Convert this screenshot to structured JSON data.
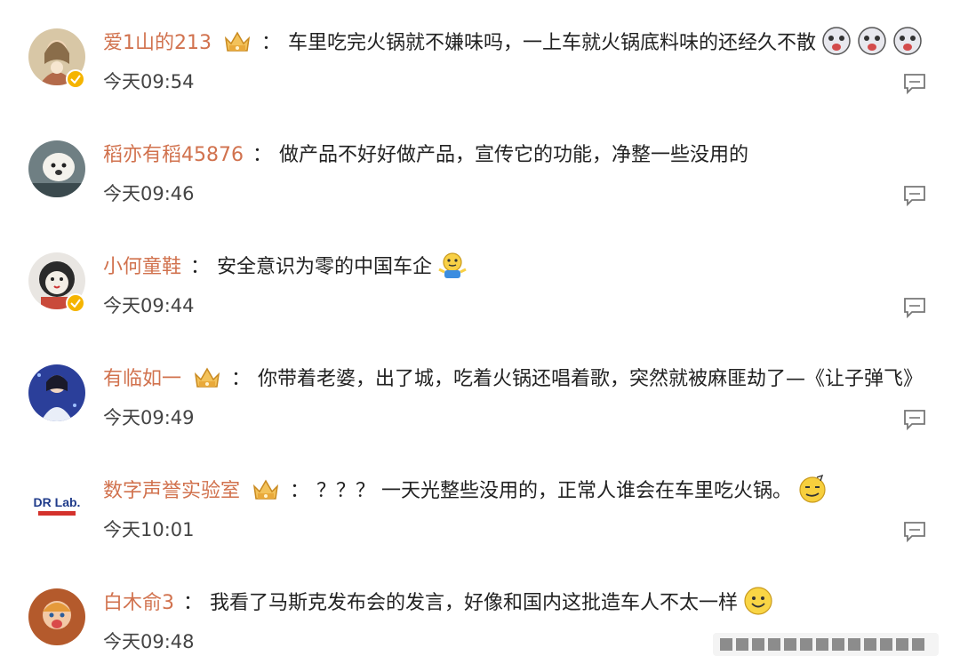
{
  "comments": [
    {
      "user": "爱1山的213",
      "separator": "：",
      "text": "车里吃完火锅就不嫌味吗，一上车就火锅底料味的还经久不散",
      "time": "今天09:54",
      "has_vip_crown": true,
      "verified": true,
      "emojis": [
        "dog-emoji-icon",
        "dog-emoji-icon",
        "dog-emoji-icon"
      ]
    },
    {
      "user": "稻亦有稻45876",
      "separator": "：",
      "text": "做产品不好好做产品，宣传它的功能，净整一些没用的",
      "time": "今天09:46",
      "has_vip_crown": false,
      "verified": false,
      "emojis": []
    },
    {
      "user": "小何童鞋",
      "separator": "：",
      "text": "安全意识为零的中国车企",
      "time": "今天09:44",
      "has_vip_crown": false,
      "verified": true,
      "emojis": [
        "shrug-emoji-icon"
      ]
    },
    {
      "user": "有临如一",
      "separator": "：",
      "text": "你带着老婆，出了城，吃着火锅还唱着歌，突然就被麻匪劫了—《让子弹飞》",
      "time": "今天09:49",
      "has_vip_crown": true,
      "verified": false,
      "emojis": []
    },
    {
      "user": "数字声誉实验室",
      "separator": "：",
      "text": "？？？ 一天光整些没用的，正常人谁会在车里吃火锅。",
      "time": "今天10:01",
      "has_vip_crown": true,
      "verified": false,
      "emojis": [
        "doge-emoji-icon"
      ]
    },
    {
      "user": "白木俞3",
      "separator": "：",
      "text": "我看了马斯克发布会的发言，好像和国内这批造车人不太一样",
      "time": "今天09:48",
      "has_vip_crown": false,
      "verified": false,
      "emojis": [
        "smile-emoji-icon"
      ]
    }
  ],
  "avatar_logo_text": "DR Lab.",
  "colors": {
    "username": "#d1724e",
    "text": "#222222",
    "time": "#444444",
    "vip_gold": "#f5b400"
  }
}
